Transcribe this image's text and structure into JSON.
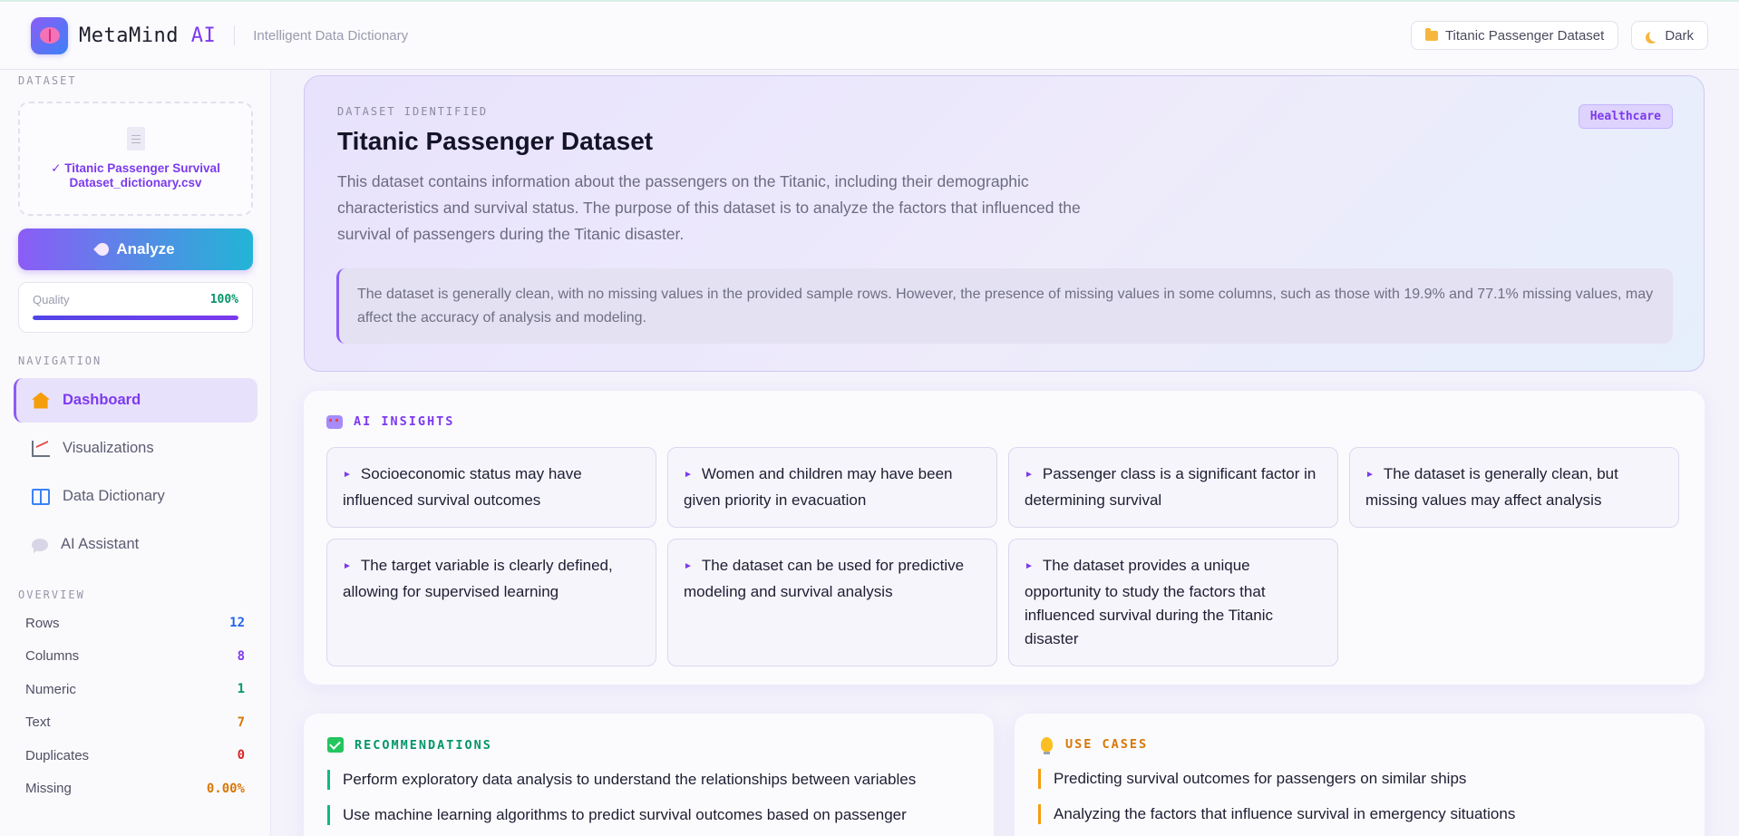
{
  "header": {
    "brand_name": "MetaMind",
    "brand_suffix": "AI",
    "tagline": "Intelligent Data Dictionary",
    "dataset_pill": "Titanic Passenger Dataset",
    "theme_toggle": "Dark"
  },
  "sidebar": {
    "dataset_label": "DATASET",
    "file_name": "✓ Titanic Passenger Survival Dataset_dictionary.csv",
    "analyze_label": "Analyze",
    "quality": {
      "label": "Quality",
      "value": "100%",
      "fraction": 1.0
    },
    "navigation_label": "NAVIGATION",
    "nav": [
      {
        "label": "Dashboard",
        "icon": "house-icon",
        "active": true
      },
      {
        "label": "Visualizations",
        "icon": "chart-icon",
        "active": false
      },
      {
        "label": "Data Dictionary",
        "icon": "book-icon",
        "active": false
      },
      {
        "label": "AI Assistant",
        "icon": "chat-icon",
        "active": false
      }
    ],
    "overview_label": "OVERVIEW",
    "overview": [
      {
        "label": "Rows",
        "value": "12",
        "color": "#2563eb"
      },
      {
        "label": "Columns",
        "value": "8",
        "color": "#7c3aed"
      },
      {
        "label": "Numeric",
        "value": "1",
        "color": "#059669"
      },
      {
        "label": "Text",
        "value": "7",
        "color": "#d97706"
      },
      {
        "label": "Duplicates",
        "value": "0",
        "color": "#dc2626"
      },
      {
        "label": "Missing",
        "value": "0.00%",
        "color": "#d97706"
      }
    ]
  },
  "hero": {
    "eyebrow": "DATASET IDENTIFIED",
    "title": "Titanic Passenger Dataset",
    "description": "This dataset contains information about the passengers on the Titanic, including their demographic characteristics and survival status. The purpose of this dataset is to analyze the factors that influenced the survival of passengers during the Titanic disaster.",
    "domain_badge": "Healthcare",
    "quality_note": "The dataset is generally clean, with no missing values in the provided sample rows. However, the presence of missing values in some columns, such as those with 19.9% and 77.1% missing values, may affect the accuracy of analysis and modeling."
  },
  "insights": {
    "title": "AI INSIGHTS",
    "title_color": "#7c3aed",
    "items": [
      "Socioeconomic status may have influenced survival outcomes",
      "Women and children may have been given priority in evacuation",
      "Passenger class is a significant factor in determining survival",
      "The dataset is generally clean, but missing values may affect analysis",
      "The target variable is clearly defined, allowing for supervised learning",
      "The dataset can be used for predictive modeling and survival analysis",
      "The dataset provides a unique opportunity to study the factors that influenced survival during the Titanic disaster"
    ]
  },
  "recommendations": {
    "title": "RECOMMENDATIONS",
    "title_color": "#059669",
    "items": [
      "Perform exploratory data analysis to understand the relationships between variables",
      "Use machine learning algorithms to predict survival outcomes based on passenger"
    ]
  },
  "use_cases": {
    "title": "USE CASES",
    "title_color": "#d97706",
    "items": [
      "Predicting survival outcomes for passengers on similar ships",
      "Analyzing the factors that influence survival in emergency situations"
    ]
  }
}
